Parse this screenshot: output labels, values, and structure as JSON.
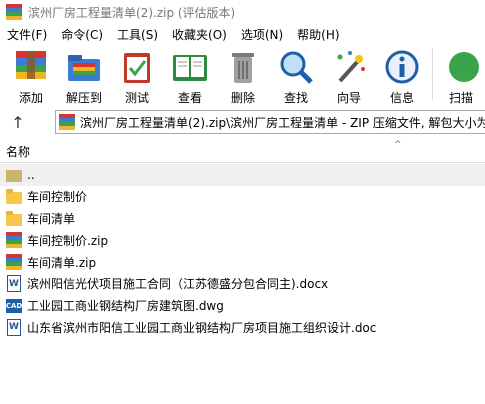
{
  "window": {
    "title": "滨州厂房工程量清单(2).zip (评估版本)"
  },
  "menu": [
    "文件(F)",
    "命令(C)",
    "工具(S)",
    "收藏夹(O)",
    "选项(N)",
    "帮助(H)"
  ],
  "toolbar": {
    "add": "添加",
    "extract": "解压到",
    "test": "测试",
    "view": "查看",
    "delete": "删除",
    "find": "查找",
    "wizard": "向导",
    "info": "信息",
    "scan": "扫描"
  },
  "address": {
    "path": "滨州厂房工程量清单(2).zip\\滨州厂房工程量清单 - ZIP 压缩文件, 解包大小为"
  },
  "columns": {
    "name": "名称"
  },
  "files": [
    {
      "name": "..",
      "type": "updir"
    },
    {
      "name": "车间控制价",
      "type": "folder"
    },
    {
      "name": "车间清单",
      "type": "folder"
    },
    {
      "name": "车间控制价.zip",
      "type": "zip"
    },
    {
      "name": "车间清单.zip",
      "type": "zip"
    },
    {
      "name": "滨州阳信光伏项目施工合同（江苏德盛分包合同主).docx",
      "type": "docx"
    },
    {
      "name": "工业园工商业钢结构厂房建筑图.dwg",
      "type": "dwg"
    },
    {
      "name": "山东省滨州市阳信工业园工商业钢结构厂房项目施工组织设计.doc",
      "type": "docx"
    }
  ],
  "colors": {
    "zip_stripes": [
      "#d9342b",
      "#3b7bd1",
      "#3ba34a",
      "#f0b429",
      "#8a4fc0"
    ],
    "folder": "#f5c84c",
    "selected_row": "#f0f0f0"
  }
}
